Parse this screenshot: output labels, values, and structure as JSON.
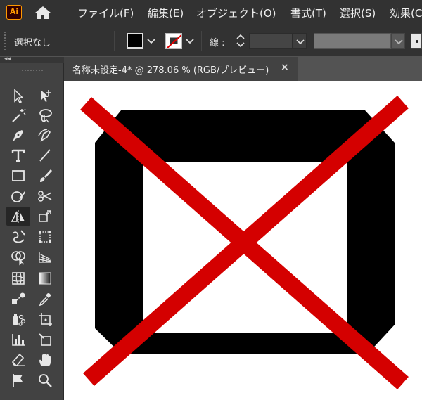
{
  "app": {
    "logo_text": "Ai",
    "logo_color": "#ff9a00",
    "menu": [
      "ファイル(F)",
      "編集(E)",
      "オブジェクト(O)",
      "書式(T)",
      "選択(S)",
      "効果(C"
    ]
  },
  "control_bar": {
    "selection_label": "選択なし",
    "fill_color": "#000000",
    "stroke_color": "none",
    "stroke_label": "線 :",
    "stroke_weight": ""
  },
  "document": {
    "tab_title": "名称未設定-4* @ 278.06 % (RGB/プレビュー)",
    "close_label": "×"
  },
  "canvas_art": {
    "frame_color": "#000000",
    "cross_color": "#d40000",
    "background": "#ffffff"
  },
  "tools": [
    "selection-tool",
    "direct-selection-tool",
    "magic-wand-tool",
    "lasso-tool",
    "pen-tool",
    "curvature-tool",
    "type-tool",
    "line-tool",
    "rectangle-tool",
    "paintbrush-tool",
    "shaper-tool",
    "scissors-tool",
    "reflect-tool",
    "free-transform-tool",
    "warp-tool",
    "perspective-tool",
    "shape-builder-tool",
    "perspective-grid-tool",
    "mesh-tool",
    "gradient-tool",
    "blend-tool",
    "eyedropper-tool",
    "symbol-sprayer-tool",
    "artboard-tool",
    "graph-tool",
    "slice-tool",
    "eraser-tool",
    "hand-tool",
    "flag-tool",
    "zoom-tool"
  ]
}
